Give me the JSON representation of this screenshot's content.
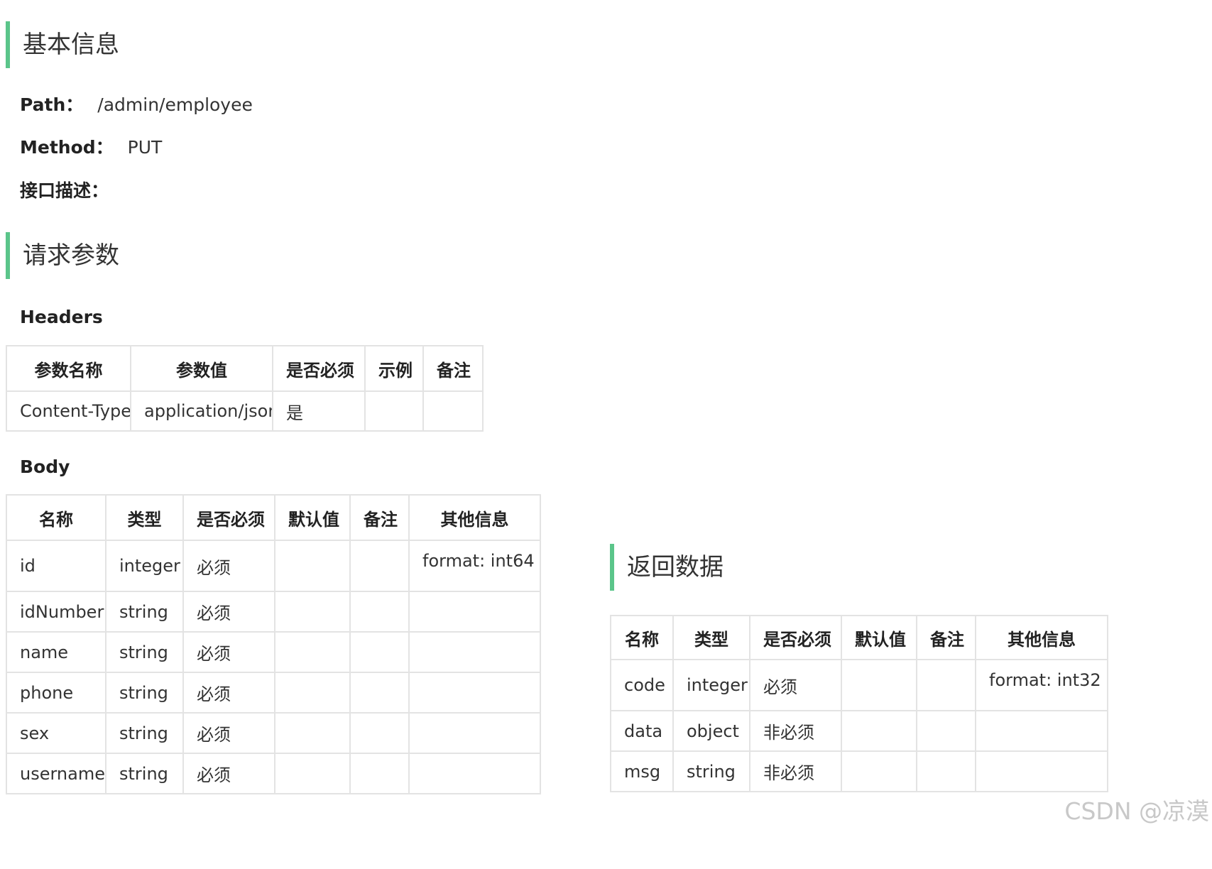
{
  "basic": {
    "title": "基本信息",
    "path_label": "Path：",
    "path_value": "/admin/employee",
    "method_label": "Method：",
    "method_value": "PUT",
    "desc_label": "接口描述："
  },
  "request": {
    "title": "请求参数",
    "headers_label": "Headers",
    "headers_table": {
      "columns": [
        "参数名称",
        "参数值",
        "是否必须",
        "示例",
        "备注"
      ],
      "rows": [
        [
          "Content-Type",
          "application/json",
          "是",
          "",
          ""
        ]
      ]
    },
    "body_label": "Body",
    "body_table": {
      "columns": [
        "名称",
        "类型",
        "是否必须",
        "默认值",
        "备注",
        "其他信息"
      ],
      "rows": [
        [
          "id",
          "integer",
          "必须",
          "",
          "",
          "format: int64"
        ],
        [
          "idNumber",
          "string",
          "必须",
          "",
          "",
          ""
        ],
        [
          "name",
          "string",
          "必须",
          "",
          "",
          ""
        ],
        [
          "phone",
          "string",
          "必须",
          "",
          "",
          ""
        ],
        [
          "sex",
          "string",
          "必须",
          "",
          "",
          ""
        ],
        [
          "username",
          "string",
          "必须",
          "",
          "",
          ""
        ]
      ]
    }
  },
  "response": {
    "title": "返回数据",
    "table": {
      "columns": [
        "名称",
        "类型",
        "是否必须",
        "默认值",
        "备注",
        "其他信息"
      ],
      "rows": [
        [
          "code",
          "integer",
          "必须",
          "",
          "",
          "format: int32"
        ],
        [
          "data",
          "object",
          "非必须",
          "",
          "",
          ""
        ],
        [
          "msg",
          "string",
          "非必须",
          "",
          "",
          ""
        ]
      ]
    }
  },
  "watermark": "CSDN @凉漠",
  "colors": {
    "accent": "#5bc58a",
    "border": "#e3e3e3",
    "text": "#333333",
    "watermark": "#c8c8c8"
  }
}
